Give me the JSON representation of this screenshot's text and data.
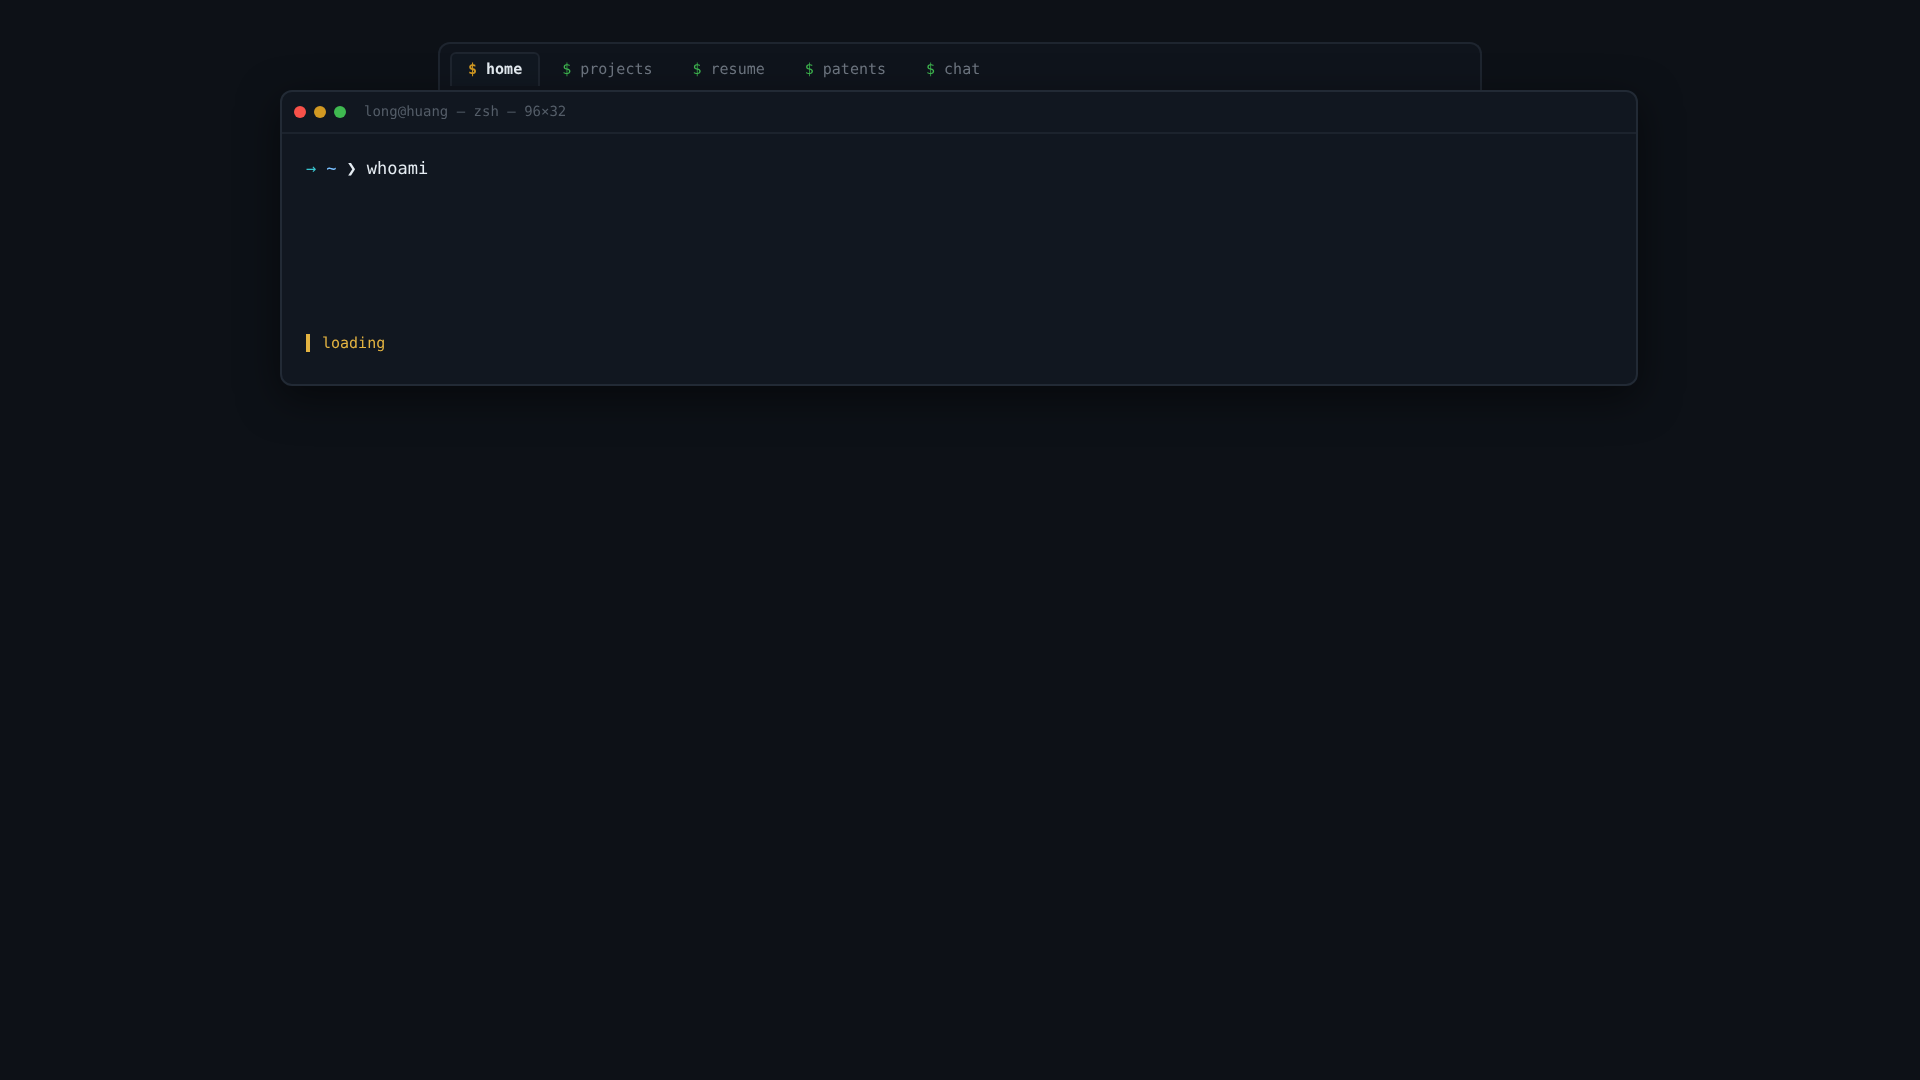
{
  "nav": {
    "tabs": [
      {
        "prompt": "$",
        "label": "home",
        "selected": true
      },
      {
        "prompt": "$",
        "label": "projects",
        "selected": false
      },
      {
        "prompt": "$",
        "label": "resume",
        "selected": false
      },
      {
        "prompt": "$",
        "label": "patents",
        "selected": false
      },
      {
        "prompt": "$",
        "label": "chat",
        "selected": false
      }
    ]
  },
  "terminal": {
    "title": "long@huang — zsh — 96×32",
    "command": {
      "arrow": "→",
      "dir": "~",
      "chevron": "❯",
      "text": "whoami"
    },
    "status": "loading"
  }
}
